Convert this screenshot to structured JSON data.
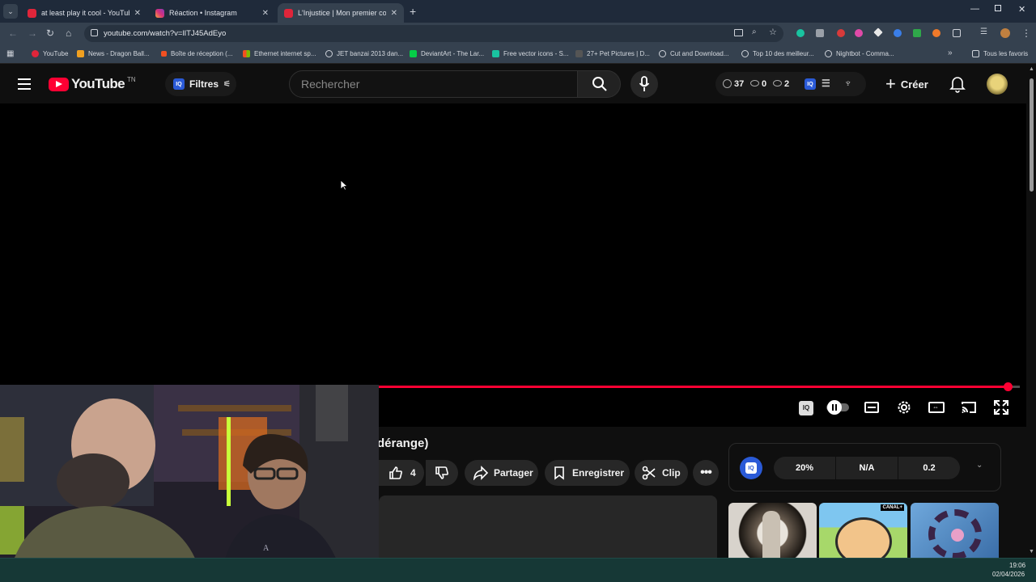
{
  "browser": {
    "tabs": [
      {
        "title": "at least play it cool - YouTube",
        "color": "#e0253a"
      },
      {
        "title": "Réaction • Instagram",
        "color": "#d6317a"
      },
      {
        "title": "L'Injustice | Mon premier court",
        "color": "#e0253a"
      }
    ],
    "url": "youtube.com/watch?v=lITJ45AdEyo",
    "bookmarks": [
      "YouTube",
      "News - Dragon Ball...",
      "Boîte de réception (...",
      "Ethernet internet sp...",
      "JET banzai 2013 dan...",
      "DeviantArt - The Lar...",
      "Free vector icons - S...",
      "27+ Pet Pictures | D...",
      "Cut and Download...",
      "Top 10 des meilleur...",
      "Nightbot - Comma..."
    ],
    "all_bookmarks": "Tous les favoris"
  },
  "youtube": {
    "logo_text": "YouTube",
    "country_code": "TN",
    "filters_label": "Filtres",
    "iq_badge": "IQ",
    "search_placeholder": "Rechercher",
    "stats": {
      "clock": "37",
      "views": "0",
      "eye": "2"
    },
    "create_label": "Créer"
  },
  "video": {
    "title_fragment": "dérange)",
    "likes": "4",
    "share_label": "Partager",
    "save_label": "Enregistrer",
    "clip_label": "Clip",
    "progress_fraction": 0.98
  },
  "iq_panel": {
    "badge": "IQ",
    "metric1": "20%",
    "metric2": "N/A",
    "metric3": "0.2"
  },
  "recommendations": {
    "thumb2_badge": "CANAL+"
  },
  "taskbar": {
    "time": "19:06",
    "date": "02/04/2026"
  }
}
